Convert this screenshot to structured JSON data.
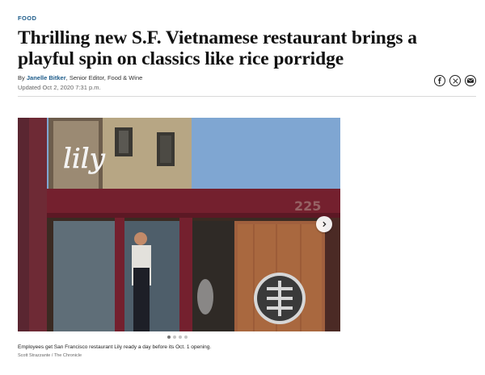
{
  "article": {
    "section": "FOOD",
    "headline": "Thrilling new S.F. Vietnamese restaurant brings a playful spin on classics like rice porridge",
    "byline_prefix": "By",
    "author": "Janelle Bitker",
    "author_title": "Senior Editor, Food & Wine",
    "updated": "Updated Oct 2, 2020 7:31 p.m."
  },
  "share": {
    "icons": [
      "facebook-icon",
      "x-icon",
      "email-icon"
    ]
  },
  "gallery": {
    "sign_text": "lily",
    "address_number": "225",
    "slide_count": 4,
    "active_slide": 1,
    "caption": "Employees get San Francisco restaurant Lily ready a day before its Oct. 1 opening.",
    "credit": "Scott Strazzante / The Chronicle"
  },
  "colors": {
    "kicker": "#1e5c8a",
    "awning": "#74202e",
    "sky": "#7fa6d2",
    "door_wood": "#a0603e"
  }
}
